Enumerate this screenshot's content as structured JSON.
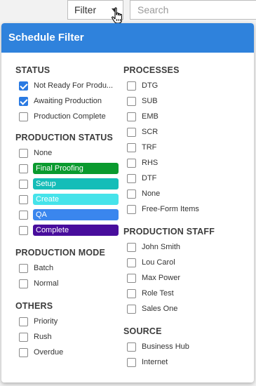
{
  "topbar": {
    "filter_label": "Filter",
    "search_placeholder": "Search"
  },
  "panel": {
    "title": "Schedule Filter"
  },
  "status": {
    "title": "STATUS",
    "items": [
      {
        "label": "Not Ready For Produ...",
        "checked": true
      },
      {
        "label": "Awaiting Production",
        "checked": true
      },
      {
        "label": "Production Complete",
        "checked": false
      }
    ]
  },
  "production_status": {
    "title": "PRODUCTION STATUS",
    "items": [
      {
        "label": "None"
      },
      {
        "label": "Final Proofing",
        "color": "#0a9a2e"
      },
      {
        "label": "Setup",
        "color": "#14bdb8"
      },
      {
        "label": "Create",
        "color": "#45e3ea"
      },
      {
        "label": "QA",
        "color": "#3a86ee"
      },
      {
        "label": "Complete",
        "color": "#480d9c"
      }
    ]
  },
  "production_mode": {
    "title": "PRODUCTION MODE",
    "items": [
      {
        "label": "Batch"
      },
      {
        "label": "Normal"
      }
    ]
  },
  "others": {
    "title": "OTHERS",
    "items": [
      {
        "label": "Priority"
      },
      {
        "label": "Rush"
      },
      {
        "label": "Overdue"
      }
    ]
  },
  "processes": {
    "title": "PROCESSES",
    "items": [
      {
        "label": "DTG"
      },
      {
        "label": "SUB"
      },
      {
        "label": "EMB"
      },
      {
        "label": "SCR"
      },
      {
        "label": "TRF"
      },
      {
        "label": "RHS"
      },
      {
        "label": "DTF"
      },
      {
        "label": "None"
      },
      {
        "label": "Free-Form Items"
      }
    ]
  },
  "production_staff": {
    "title": "PRODUCTION STAFF",
    "items": [
      {
        "label": "John Smith"
      },
      {
        "label": "Lou Carol"
      },
      {
        "label": "Max Power"
      },
      {
        "label": "Role Test"
      },
      {
        "label": "Sales One"
      }
    ]
  },
  "source": {
    "title": "SOURCE",
    "items": [
      {
        "label": "Business Hub"
      },
      {
        "label": "Internet"
      }
    ]
  },
  "colors": {
    "header": "#2f82dc",
    "checkbox_checked": "#2a7ae2"
  },
  "icons": [
    "caret-down-icon",
    "hand-pointer-icon",
    "checkmark-icon"
  ]
}
